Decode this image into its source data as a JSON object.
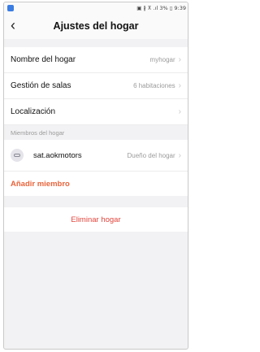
{
  "status": {
    "right": "▣ ∦ ⊼ .ıl 3% ▯ 9:39"
  },
  "header": {
    "back_icon": "back-chevron-icon",
    "title": "Ajustes del hogar"
  },
  "settings": [
    {
      "label": "Nombre del hogar",
      "value": "myhogar"
    },
    {
      "label": "Gestión de salas",
      "value": "6 habitaciones"
    },
    {
      "label": "Localización",
      "value": ""
    }
  ],
  "members_section": {
    "label": "Miembros del hogar",
    "members": [
      {
        "name": "sat.aokmotors",
        "role": "Dueño del hogar"
      }
    ],
    "add_label": "Añadir miembro"
  },
  "delete_label": "Eliminar hogar",
  "colors": {
    "accent_orange": "#e8643c",
    "danger_red": "#e2453c",
    "background": "#f2f2f4"
  }
}
